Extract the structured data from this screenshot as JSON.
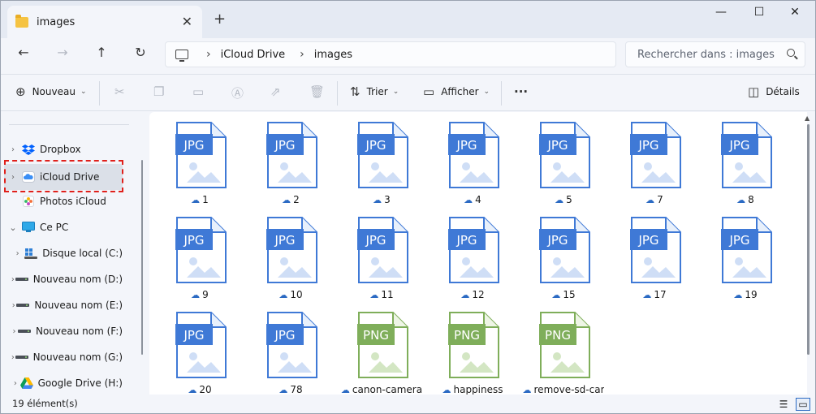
{
  "tab": {
    "title": "images",
    "close": "✕",
    "new": "+"
  },
  "window_controls": {
    "minimize": "—",
    "maximize": "☐",
    "close": "✕"
  },
  "nav": {
    "back": "←",
    "forward": "→",
    "up": "↑",
    "refresh": "↻"
  },
  "address": {
    "crumbs": [
      "iCloud Drive",
      "images"
    ],
    "separator": "›"
  },
  "search": {
    "placeholder": "Rechercher dans : images"
  },
  "toolbar": {
    "new_label": "Nouveau",
    "sort_label": "Trier",
    "view_label": "Afficher",
    "more": "···",
    "details_label": "Détails"
  },
  "sidebar": {
    "items": [
      {
        "label": "Dropbox",
        "icon": "dropbox-icon",
        "arrow": "›"
      },
      {
        "label": "iCloud Drive",
        "icon": "icloud-icon",
        "arrow": "›",
        "selected": true
      },
      {
        "label": "Photos iCloud",
        "icon": "photos-icon",
        "arrow": ""
      },
      {
        "label": "Ce PC",
        "icon": "pc-icon",
        "arrow": "⌄"
      },
      {
        "label": "Disque local (C:)",
        "icon": "windows-drive-icon",
        "arrow": "›"
      },
      {
        "label": "Nouveau nom (D:)",
        "icon": "drive-icon",
        "arrow": "›"
      },
      {
        "label": "Nouveau nom (E:)",
        "icon": "drive-icon",
        "arrow": "›"
      },
      {
        "label": "Nouveau nom (F:)",
        "icon": "drive-icon",
        "arrow": "›"
      },
      {
        "label": "Nouveau nom (G:)",
        "icon": "drive-icon",
        "arrow": "›"
      },
      {
        "label": "Google Drive (H:)",
        "icon": "google-drive-icon",
        "arrow": "›"
      }
    ]
  },
  "files": [
    {
      "name": "1",
      "type": "JPG"
    },
    {
      "name": "2",
      "type": "JPG"
    },
    {
      "name": "3",
      "type": "JPG"
    },
    {
      "name": "4",
      "type": "JPG"
    },
    {
      "name": "5",
      "type": "JPG"
    },
    {
      "name": "7",
      "type": "JPG"
    },
    {
      "name": "8",
      "type": "JPG"
    },
    {
      "name": "9",
      "type": "JPG"
    },
    {
      "name": "10",
      "type": "JPG"
    },
    {
      "name": "11",
      "type": "JPG"
    },
    {
      "name": "12",
      "type": "JPG"
    },
    {
      "name": "15",
      "type": "JPG"
    },
    {
      "name": "17",
      "type": "JPG"
    },
    {
      "name": "19",
      "type": "JPG"
    },
    {
      "name": "20",
      "type": "JPG"
    },
    {
      "name": "78",
      "type": "JPG"
    },
    {
      "name": "canon-camera",
      "type": "PNG"
    },
    {
      "name": "happiness",
      "type": "PNG"
    },
    {
      "name": "remove-sd-car",
      "type": "PNG"
    }
  ],
  "colors": {
    "jpg": "#3f79d6",
    "png": "#7fae5a",
    "accent": "#2b6ac3",
    "highlight": "#e0201b"
  },
  "status": {
    "count": "19 élément(s)"
  }
}
